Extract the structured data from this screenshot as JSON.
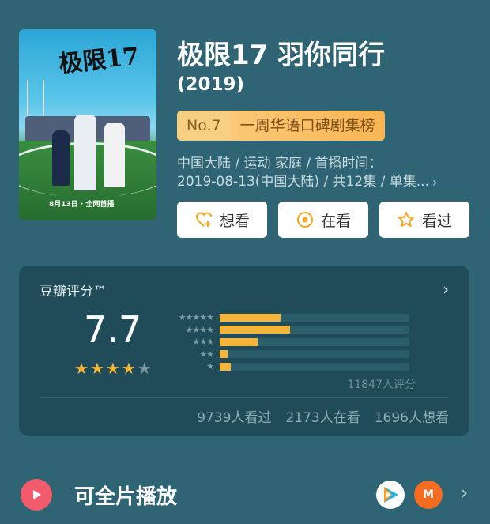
{
  "poster": {
    "title": "极限17",
    "date_text": "8月13日 · 全网首播"
  },
  "show": {
    "title": "极限17 羽你同行",
    "year": "(2019)"
  },
  "rank": {
    "no": "No.7",
    "name": "一周华语口碑剧集榜"
  },
  "meta": {
    "line1": "中国大陆 / 运动 家庭 / 首播时间：",
    "line2": "2019-08-13(中国大陆) / 共12集 / 单集..."
  },
  "buttons": {
    "want": "想看",
    "watching": "在看",
    "watched": "看过"
  },
  "rating": {
    "header": "豆瓣评分™",
    "score": "7.7",
    "stars_filled": 4,
    "stars_total": 5,
    "distribution": [
      {
        "stars": "★★★★★",
        "fraction": 0.32
      },
      {
        "stars": "★★★★",
        "fraction": 0.37
      },
      {
        "stars": "★★★",
        "fraction": 0.2
      },
      {
        "stars": "★★",
        "fraction": 0.04
      },
      {
        "stars": "★",
        "fraction": 0.06
      }
    ],
    "count_text": "11847人评分",
    "stats": {
      "watched": "9739人看过",
      "watching": "2173人在看",
      "want": "1696人想看"
    }
  },
  "playback": {
    "label": "可全片播放",
    "source2_text": "M"
  },
  "colors": {
    "background": "#2f6474",
    "card": "#1f4c58",
    "star": "#f5b53b",
    "accent_gold": "#fbc36a",
    "play_red": "#f15b6c"
  }
}
